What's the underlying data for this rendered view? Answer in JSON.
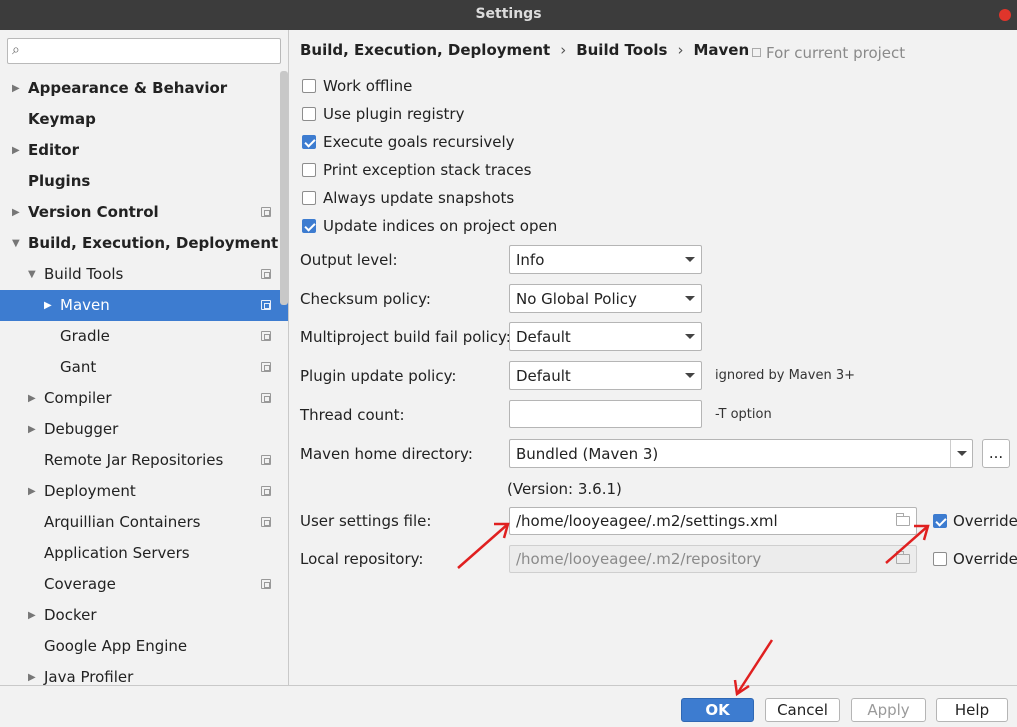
{
  "window": {
    "title": "Settings"
  },
  "search": {
    "placeholder": ""
  },
  "sidebar": {
    "items": [
      {
        "label": "Appearance & Behavior",
        "bold": true,
        "arrow": "▶",
        "proj": false
      },
      {
        "label": "Keymap",
        "bold": true,
        "arrow": "",
        "proj": false
      },
      {
        "label": "Editor",
        "bold": true,
        "arrow": "▶",
        "proj": false
      },
      {
        "label": "Plugins",
        "bold": true,
        "arrow": "",
        "proj": false
      },
      {
        "label": "Version Control",
        "bold": true,
        "arrow": "▶",
        "proj": true
      },
      {
        "label": "Build, Execution, Deployment",
        "bold": true,
        "arrow": "▼",
        "proj": false
      },
      {
        "label": "Build Tools",
        "bold": false,
        "arrow": "▼",
        "proj": true
      },
      {
        "label": "Maven",
        "bold": false,
        "arrow": "▶",
        "proj": true,
        "selected": true
      },
      {
        "label": "Gradle",
        "bold": false,
        "arrow": "",
        "proj": true
      },
      {
        "label": "Gant",
        "bold": false,
        "arrow": "",
        "proj": true
      },
      {
        "label": "Compiler",
        "bold": false,
        "arrow": "▶",
        "proj": true
      },
      {
        "label": "Debugger",
        "bold": false,
        "arrow": "▶",
        "proj": false
      },
      {
        "label": "Remote Jar Repositories",
        "bold": false,
        "arrow": "",
        "proj": true
      },
      {
        "label": "Deployment",
        "bold": false,
        "arrow": "▶",
        "proj": true
      },
      {
        "label": "Arquillian Containers",
        "bold": false,
        "arrow": "",
        "proj": true
      },
      {
        "label": "Application Servers",
        "bold": false,
        "arrow": "",
        "proj": false
      },
      {
        "label": "Coverage",
        "bold": false,
        "arrow": "",
        "proj": true
      },
      {
        "label": "Docker",
        "bold": false,
        "arrow": "▶",
        "proj": false
      },
      {
        "label": "Google App Engine",
        "bold": false,
        "arrow": "",
        "proj": false
      },
      {
        "label": "Java Profiler",
        "bold": false,
        "arrow": "▶",
        "proj": false
      }
    ]
  },
  "breadcrumb": {
    "part1": "Build, Execution, Deployment",
    "part2": "Build Tools",
    "part3": "Maven",
    "separator": "›"
  },
  "scope_note": "For current project",
  "checkboxes": {
    "work_offline": {
      "label": "Work offline",
      "checked": false
    },
    "use_plugin_registry": {
      "label": "Use plugin registry",
      "checked": false
    },
    "execute_goals_recursively": {
      "label": "Execute goals recursively",
      "checked": true
    },
    "print_exception_stack_traces": {
      "label": "Print exception stack traces",
      "checked": false
    },
    "always_update_snapshots": {
      "label": "Always update snapshots",
      "checked": false
    },
    "update_indices": {
      "label": "Update indices on project open",
      "checked": true
    }
  },
  "form": {
    "output_level": {
      "label": "Output level:",
      "value": "Info"
    },
    "checksum_policy": {
      "label": "Checksum policy:",
      "value": "No Global Policy"
    },
    "multiproject_fail_policy": {
      "label": "Multiproject build fail policy:",
      "value": "Default"
    },
    "plugin_update_policy": {
      "label": "Plugin update policy:",
      "value": "Default",
      "hint": "ignored by Maven 3+"
    },
    "thread_count": {
      "label": "Thread count:",
      "value": "",
      "hint": "-T option"
    },
    "maven_home": {
      "label": "Maven home directory:",
      "value": "Bundled (Maven 3)",
      "browse": "...",
      "version": "(Version: 3.6.1)"
    },
    "user_settings": {
      "label": "User settings file:",
      "value": "/home/looyeagee/.m2/settings.xml",
      "override_label": "Override",
      "override": true
    },
    "local_repo": {
      "label": "Local repository:",
      "value": "/home/looyeagee/.m2/repository",
      "override_label": "Override",
      "override": false
    }
  },
  "buttons": {
    "ok": "OK",
    "cancel": "Cancel",
    "apply": "Apply",
    "help": "Help"
  },
  "colors": {
    "accent": "#3d7cd0",
    "annotation_arrow": "#e02020",
    "titlebar": "#3c3c3c"
  }
}
